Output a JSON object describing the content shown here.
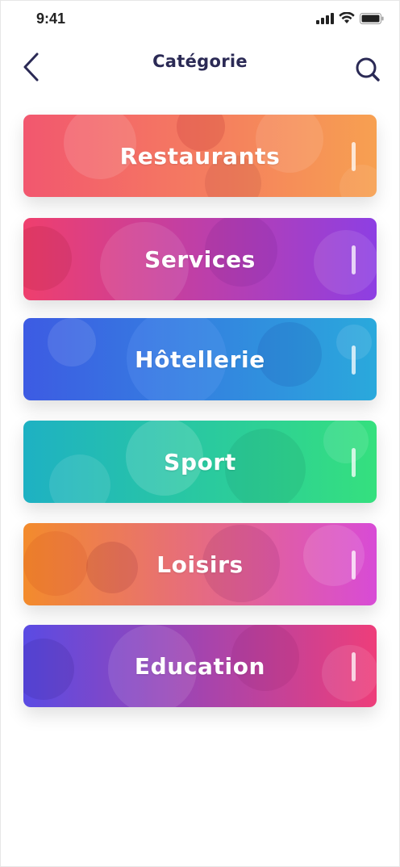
{
  "status_bar": {
    "time": "9:41"
  },
  "header": {
    "title": "Catégorie"
  },
  "categories": [
    {
      "label": "Restaurants",
      "colors": [
        "#f2576f",
        "#f7a051"
      ]
    },
    {
      "label": "Services",
      "colors": [
        "#ef3f6d",
        "#8d3fe3"
      ]
    },
    {
      "label": "Hôtellerie",
      "colors": [
        "#3d5be3",
        "#2aa9dc"
      ]
    },
    {
      "label": "Sport",
      "colors": [
        "#1eb1c3",
        "#35e07e"
      ]
    },
    {
      "label": "Loisirs",
      "colors": [
        "#f38b2c",
        "#d84bd6"
      ]
    },
    {
      "label": "Education",
      "colors": [
        "#5a4be3",
        "#ee3e7a"
      ]
    }
  ],
  "theme": {
    "title_color": "#2b2a55"
  }
}
